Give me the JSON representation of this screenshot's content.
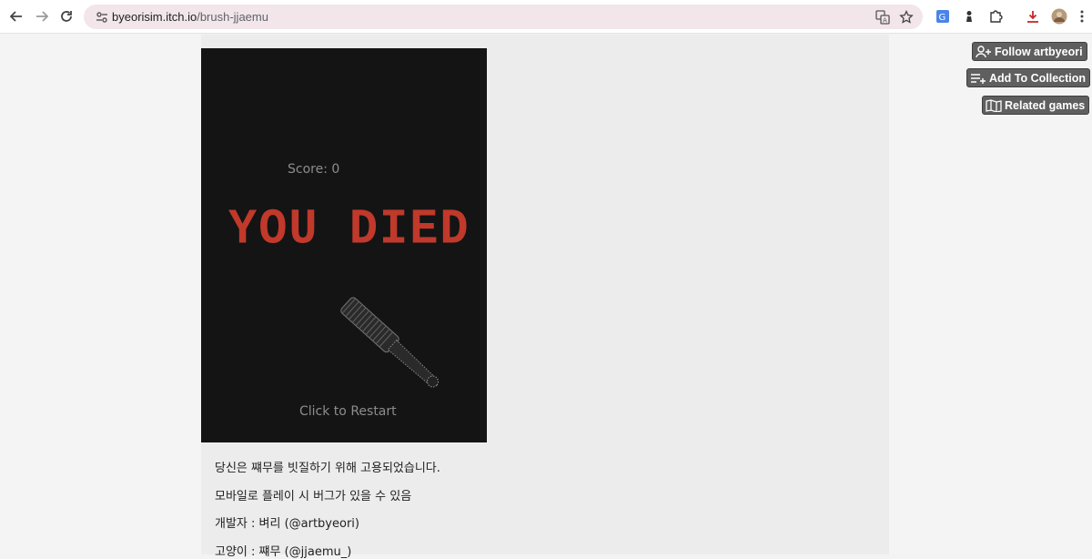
{
  "browser": {
    "url_host": "byeorisim.itch.io",
    "url_path": "/brush-jjaemu",
    "back_icon": "arrow-left",
    "forward_icon": "arrow-right",
    "reload_icon": "reload",
    "site_info_icon": "tune",
    "translate_icon": "translate",
    "bookmark_icon": "star"
  },
  "sidebar_actions": {
    "follow_label": "Follow artbyeori",
    "add_collection_label": "Add To Collection",
    "related_label": "Related games"
  },
  "game": {
    "score_text": "Score: 0",
    "died_text": "YOU DIED",
    "restart_text": "Click to Restart",
    "died_color": "#c0392b"
  },
  "description": {
    "line1": "당신은 쨰무를 빗질하기 위해 고용되었습니다.",
    "line2": "모바일로 플레이 시 버그가 있을 수 있음",
    "line3": "개발자 : 벼리 (@artbyeori)",
    "line4": "고양이 : 쨰무 (@jjaemu_)"
  }
}
